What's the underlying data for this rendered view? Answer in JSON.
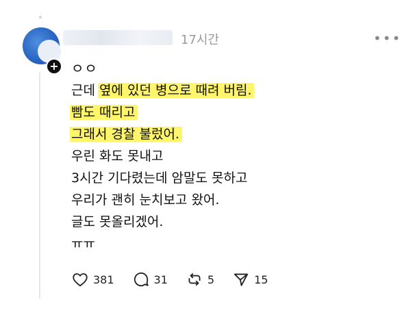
{
  "post": {
    "timestamp": "17시간",
    "lines": [
      {
        "text": "ㅇㅇ"
      },
      {
        "pre": "근데 ",
        "hl": "옆에 있던 병으로 때려 버림."
      },
      {
        "hl": "빰도 때리고"
      },
      {
        "hl": "그래서 경찰 불렀어."
      },
      {
        "text": "우린 화도 못내고"
      },
      {
        "text": "3시간 기다렸는데 암말도 못하고"
      },
      {
        "text": "우리가 괜히 눈치보고 왔어."
      },
      {
        "text": "글도 못올리겠어."
      },
      {
        "text": "ㅠㅠ"
      }
    ]
  },
  "actions": {
    "likes": "381",
    "comments": "31",
    "reposts": "5",
    "shares": "15"
  },
  "icons": {
    "more": "more-icon",
    "like": "heart-icon",
    "comment": "comment-icon",
    "repost": "repost-icon",
    "share": "send-icon"
  }
}
